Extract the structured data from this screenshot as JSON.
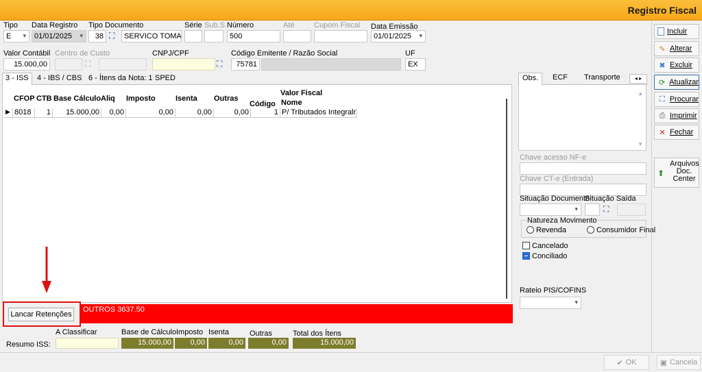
{
  "window": {
    "title": "Registro Fiscal"
  },
  "header": {
    "tipo": {
      "label": "Tipo",
      "value": "E"
    },
    "data_registro": {
      "label": "Data Registro",
      "value": "01/01/2025"
    },
    "tipo_documento": {
      "label": "Tipo Documento",
      "code": "38",
      "value": "SERVICO TOMAD"
    },
    "serie": {
      "label": "Série",
      "value": ""
    },
    "sub_serie": {
      "label": "Sub.S.",
      "value": ""
    },
    "numero": {
      "label": "Número",
      "value": "500"
    },
    "ate": {
      "label": "Até",
      "value": ""
    },
    "cupom_fiscal": {
      "label": "Cupom Fiscal",
      "value": ""
    },
    "data_emissao": {
      "label": "Data Emissão",
      "value": "01/01/2025"
    },
    "valor_contabil": {
      "label": "Valor Contábil",
      "value": "15.000,00"
    },
    "centro_custo": {
      "label": "Centro de Custo",
      "value": ""
    },
    "cnpj_cpf": {
      "label": "CNPJ/CPF",
      "value": ""
    },
    "codigo_emitente": {
      "label": "Código Emitente / Razão Social",
      "value": "75781",
      "razao_social": ""
    },
    "uf": {
      "label": "UF",
      "value": "EX"
    }
  },
  "tabs": [
    {
      "label": "3 - ISS",
      "active": true
    },
    {
      "label": "4 - IBS / CBS",
      "active": false
    },
    {
      "label": "6 - Ítens da Nota: 1",
      "active": false
    },
    {
      "label": "SPED",
      "active": false
    }
  ],
  "grid": {
    "group_header": "Valor Fiscal",
    "columns": [
      "CFOP",
      "CTB",
      "Base Cálculo",
      "Aliq",
      "Imposto",
      "Isenta",
      "Outras",
      "Código",
      "Nome"
    ],
    "rows": [
      {
        "cfop": "8018",
        "ctb": "1",
        "base": "15.000,00",
        "aliq": "0,00",
        "imposto": "0,00",
        "isenta": "0,00",
        "outras": "0,00",
        "codigo": "1",
        "nome": "P/ Tributados Integralmer"
      }
    ]
  },
  "retencoes": {
    "button_label": "Lancar Retenções",
    "message": "OUTROS 3637.50",
    "alert_color": "#ff0000"
  },
  "summary": {
    "resumo_label": "Resumo ISS:",
    "a_classificar": {
      "label": "A Classificar",
      "value": ""
    },
    "base_calculo": {
      "label": "Base de Cálculo",
      "value": "15.000,00"
    },
    "imposto": {
      "label": "Imposto",
      "value": "0,00"
    },
    "isenta": {
      "label": "Isenta",
      "value": "0,00"
    },
    "outras": {
      "label": "Outras",
      "value": "0,00"
    },
    "total_itens": {
      "label": "Total dos Ítens",
      "value": "15.000,00"
    }
  },
  "right_panel": {
    "tabs": [
      "Obs.",
      "ECF",
      "Transporte"
    ],
    "chave_nfe": {
      "label": "Chave acesso NF-e",
      "value": ""
    },
    "chave_cte": {
      "label": "Chave CT-e (Entrada)",
      "value": ""
    },
    "situacao_documento": {
      "label": "Situação Documento",
      "value": ""
    },
    "situacao_saida": {
      "label": "Situação Saída",
      "value": ""
    },
    "natureza": {
      "label": "Natureza Movimento",
      "options": [
        "Revenda",
        "Consumidor Final"
      ]
    },
    "cancelado": {
      "label": "Cancelado",
      "checked": false
    },
    "conciliado": {
      "label": "Conciliado",
      "checked": true
    },
    "rateio": {
      "label": "Rateio PIS/COFINS",
      "value": ""
    }
  },
  "sidebar": {
    "buttons": [
      {
        "label": "Incluir",
        "icon": "page-icon"
      },
      {
        "label": "Alterar",
        "icon": "edit-icon"
      },
      {
        "label": "Excluir",
        "icon": "delete-icon"
      },
      {
        "label": "Atualizar",
        "icon": "refresh-icon"
      },
      {
        "label": "Procurar",
        "icon": "binoculars-icon"
      },
      {
        "label": "Imprimir",
        "icon": "printer-icon"
      },
      {
        "label": "Fechar",
        "icon": "close-icon"
      }
    ],
    "arquivos": {
      "label": "Arquivos Doc. Center"
    }
  },
  "footer": {
    "ok_label": "OK",
    "cancel_label": "Cancela"
  },
  "colors": {
    "title_bar": "#f7a71a",
    "alert": "#ff0000",
    "summary_fields": "#7d7d2e",
    "annotation": "#e01010"
  }
}
